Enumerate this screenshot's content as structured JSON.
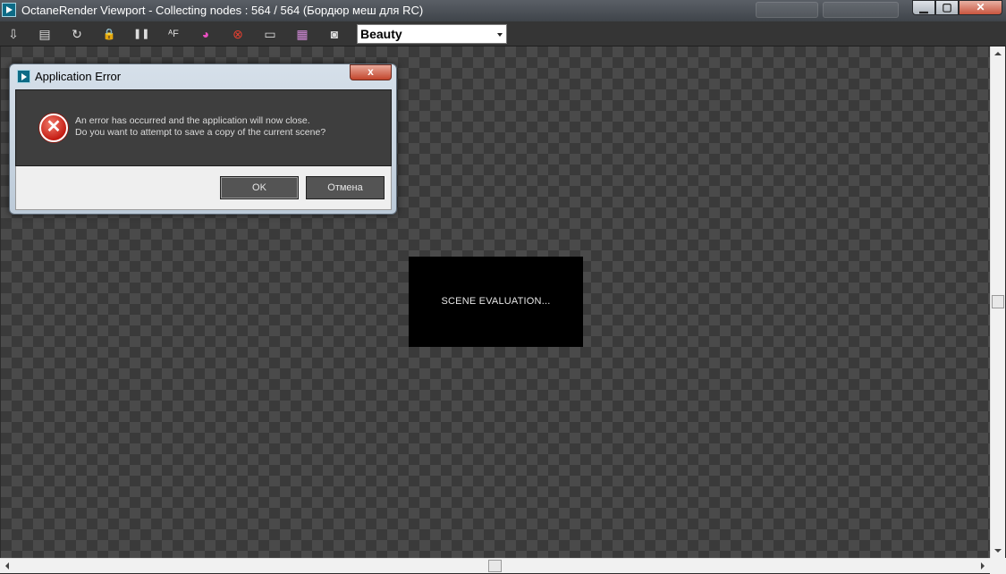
{
  "window": {
    "title": "OctaneRender Viewport - Collecting nodes : 564 / 564 (Бордюр меш для RC)",
    "controls": [
      "minimize-icon",
      "maximize-icon",
      "close-icon"
    ],
    "control_glyphs": {
      "minimize": "▁",
      "maximize": "▢",
      "close": "✕"
    }
  },
  "toolbar": {
    "tools": [
      {
        "name": "export-icon",
        "glyph": "⇩"
      },
      {
        "name": "clipboard-icon",
        "glyph": "▤"
      },
      {
        "name": "refresh-icon",
        "glyph": "↻"
      },
      {
        "name": "lock-icon",
        "glyph": "🔒"
      },
      {
        "name": "pause-icon",
        "glyph": "❚❚"
      },
      {
        "name": "focus-icon",
        "glyph": "ᴬF"
      },
      {
        "name": "color-picker-icon",
        "glyph": "◕"
      },
      {
        "name": "region-icon",
        "glyph": "⊗"
      },
      {
        "name": "display-icon",
        "glyph": "▭"
      },
      {
        "name": "film-icon",
        "glyph": "▦"
      },
      {
        "name": "camera-icon",
        "glyph": "◙"
      }
    ],
    "render_pass": "Beauty"
  },
  "viewport": {
    "status": "SCENE EVALUATION..."
  },
  "dialog": {
    "title": "Application Error",
    "close_glyph": "x",
    "error_glyph": "✕",
    "message_line1": "An error has occurred and the application will now close.",
    "message_line2": "Do you want to attempt to save a copy of the current scene?",
    "ok_label": "OK",
    "cancel_label": "Отмена"
  },
  "colors": {
    "viewport_bg": "#3a3a3a",
    "error_red": "#c51d14",
    "dialog_body": "#3e3e3e"
  }
}
